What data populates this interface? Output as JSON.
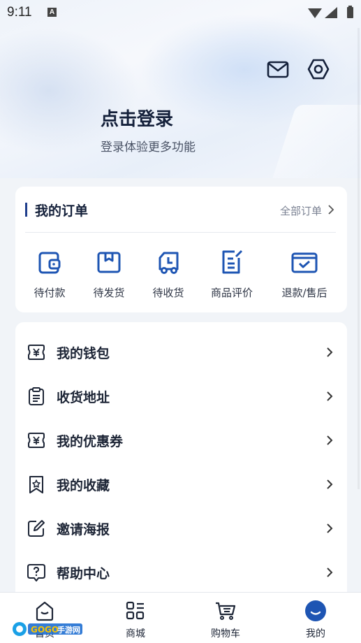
{
  "status_bar": {
    "time": "9:11",
    "a_badge": "A"
  },
  "header": {
    "login_title": "点击登录",
    "login_subtitle": "登录体验更多功能",
    "icons": [
      "mail-icon",
      "settings-icon"
    ]
  },
  "orders": {
    "title": "我的订单",
    "view_all": "全部订单",
    "items": [
      {
        "label": "待付款",
        "icon": "wallet-icon"
      },
      {
        "label": "待发货",
        "icon": "package-icon"
      },
      {
        "label": "待收货",
        "icon": "truck-icon"
      },
      {
        "label": "商品评价",
        "icon": "review-icon"
      },
      {
        "label": "退款/售后",
        "icon": "refund-icon"
      }
    ]
  },
  "menu": {
    "items": [
      {
        "label": "我的钱包",
        "icon": "yen-wallet-icon"
      },
      {
        "label": "收货地址",
        "icon": "clipboard-icon"
      },
      {
        "label": "我的优惠券",
        "icon": "coupon-icon"
      },
      {
        "label": "我的收藏",
        "icon": "star-bookmark-icon"
      },
      {
        "label": "邀请海报",
        "icon": "edit-icon"
      },
      {
        "label": "帮助中心",
        "icon": "help-icon"
      }
    ]
  },
  "tabbar": {
    "tabs": [
      {
        "label": "首页",
        "icon": "home-icon"
      },
      {
        "label": "商城",
        "icon": "grid-icon"
      },
      {
        "label": "购物车",
        "icon": "cart-icon"
      },
      {
        "label": "我的",
        "icon": "profile-icon"
      }
    ],
    "active_index": 3
  },
  "watermark": {
    "text": "GOGO手游网"
  },
  "colors": {
    "accent": "#1f3e8c",
    "icon_blue": "#1e55b3",
    "background": "#f1f4f8"
  }
}
